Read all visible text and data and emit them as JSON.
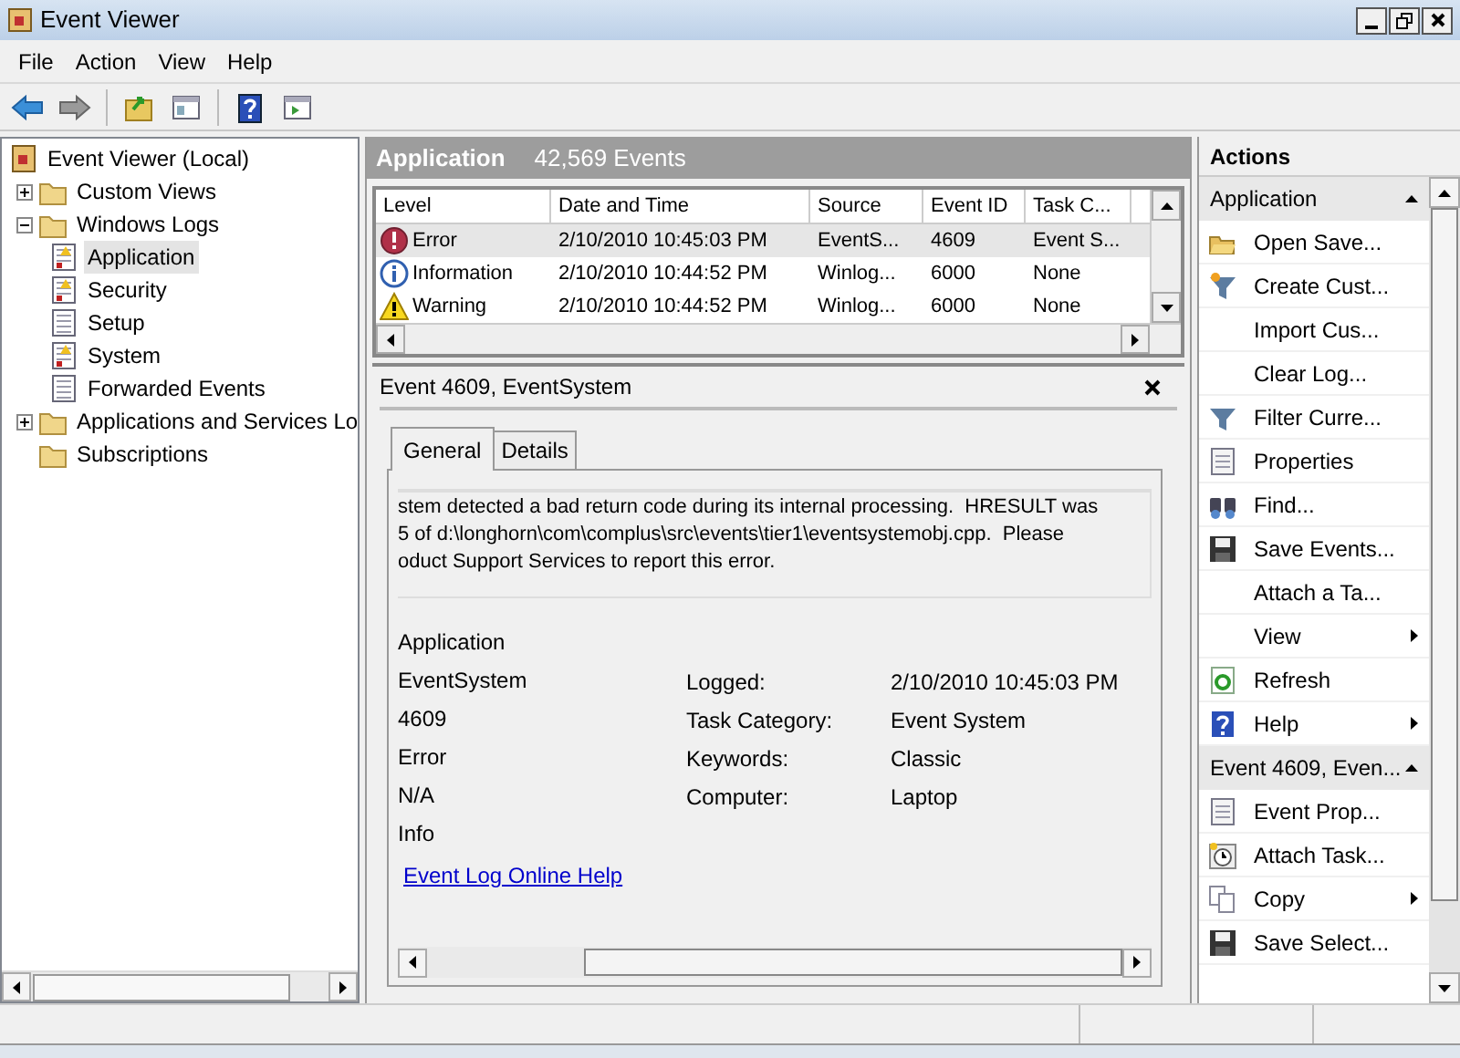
{
  "window": {
    "title": "Event Viewer"
  },
  "menu": [
    "File",
    "Action",
    "View",
    "Help"
  ],
  "toolbar": [
    {
      "kind": "back"
    },
    {
      "kind": "forward"
    },
    {
      "kind": "sep"
    },
    {
      "kind": "up"
    },
    {
      "kind": "pane"
    },
    {
      "kind": "sep"
    },
    {
      "kind": "help"
    },
    {
      "kind": "pane2"
    }
  ],
  "tree": [
    {
      "label": "Event Viewer (Local)",
      "kind": "root",
      "selected": false,
      "children": [
        {
          "label": "Custom Views",
          "kind": "folder",
          "expanded": false,
          "selected": false
        },
        {
          "label": "Windows Logs",
          "kind": "folder",
          "expanded": true,
          "selected": false,
          "children": [
            {
              "label": "Application",
              "kind": "log",
              "selected": true
            },
            {
              "label": "Security",
              "kind": "log",
              "selected": false
            },
            {
              "label": "Setup",
              "kind": "plain",
              "selected": false
            },
            {
              "label": "System",
              "kind": "log",
              "selected": false
            },
            {
              "label": "Forwarded Events",
              "kind": "plain",
              "selected": false
            }
          ]
        },
        {
          "label": "Applications and Services Lo",
          "kind": "folder",
          "expanded": false,
          "selected": false
        },
        {
          "label": "Subscriptions",
          "kind": "folder",
          "selected": false
        }
      ]
    }
  ],
  "log_header": {
    "title": "Application",
    "count": "42,569 Events"
  },
  "table": {
    "columns": [
      "Level",
      "Date and Time",
      "Source",
      "Event ID",
      "Task C..."
    ],
    "rows": [
      {
        "kind": "error",
        "selected": true,
        "cells": [
          "Error",
          "2/10/2010 10:45:03 PM",
          "EventS...",
          "4609",
          "Event S..."
        ]
      },
      {
        "kind": "information",
        "selected": false,
        "cells": [
          "Information",
          "2/10/2010 10:44:52 PM",
          "Winlog...",
          "6000",
          "None"
        ]
      },
      {
        "kind": "warning",
        "selected": false,
        "cells": [
          "Warning",
          "2/10/2010 10:44:52 PM",
          "Winlog...",
          "6000",
          "None"
        ]
      }
    ]
  },
  "detail": {
    "title": "Event 4609, EventSystem",
    "tabs": [
      {
        "label": "General",
        "selected": true
      },
      {
        "label": "Details",
        "selected": false
      }
    ],
    "description_lines": [
      "stem detected a bad return code during its internal processing.  HRESULT was",
      "5 of d:\\longhorn\\com\\complus\\src\\events\\tier1\\eventsystemobj.cpp.  Please",
      "oduct Support Services to report this error."
    ],
    "left_values": [
      "Application",
      "EventSystem",
      "4609",
      "Error",
      "N/A",
      "Info"
    ],
    "right_fields": [
      {
        "label": "Logged:",
        "value": "2/10/2010 10:45:03 PM"
      },
      {
        "label": "Task Category:",
        "value": "Event System"
      },
      {
        "label": "Keywords:",
        "value": "Classic"
      },
      {
        "label": "Computer:",
        "value": "Laptop"
      }
    ],
    "link": "Event Log Online Help"
  },
  "actions": {
    "title": "Actions",
    "sections": [
      {
        "title": "Application",
        "expanded": true,
        "items": [
          {
            "label": "Open Save...",
            "kind": "folder",
            "submenu": false
          },
          {
            "label": "Create Cust...",
            "kind": "custom-filter",
            "submenu": false
          },
          {
            "label": "Import Cus...",
            "kind": "plain",
            "submenu": false
          },
          {
            "label": "Clear Log...",
            "kind": "plain",
            "submenu": false
          },
          {
            "label": "Filter Curre...",
            "kind": "filter",
            "submenu": false
          },
          {
            "label": "Properties",
            "kind": "properties",
            "submenu": false
          },
          {
            "label": "Find...",
            "kind": "find",
            "submenu": false
          },
          {
            "label": "Save Events...",
            "kind": "save",
            "submenu": false
          },
          {
            "label": "Attach a Ta...",
            "kind": "plain",
            "submenu": false
          },
          {
            "label": "View",
            "kind": "plain",
            "submenu": true
          },
          {
            "label": "Refresh",
            "kind": "refresh",
            "submenu": false
          },
          {
            "label": "Help",
            "kind": "help",
            "submenu": true
          }
        ]
      },
      {
        "title": "Event 4609, Even...",
        "expanded": true,
        "items": [
          {
            "label": "Event Prop...",
            "kind": "properties",
            "submenu": false
          },
          {
            "label": "Attach Task...",
            "kind": "task",
            "submenu": false
          },
          {
            "label": "Copy",
            "kind": "copy",
            "submenu": true
          },
          {
            "label": "Save Select...",
            "kind": "save",
            "submenu": false
          }
        ]
      }
    ]
  }
}
